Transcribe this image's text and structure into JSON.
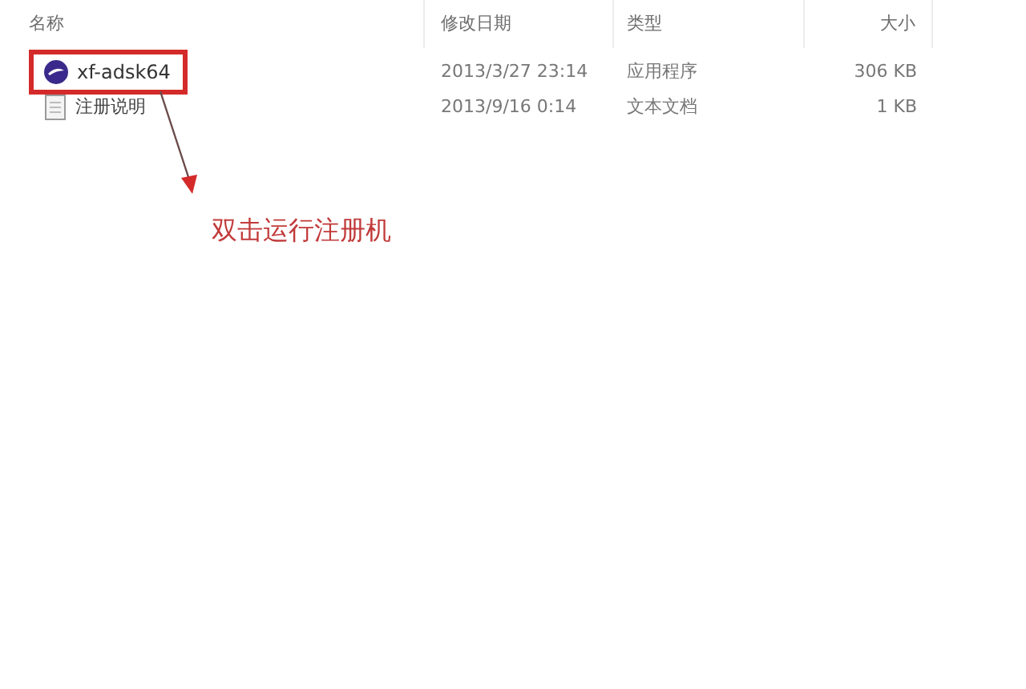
{
  "columns": [
    "名称",
    "修改日期",
    "类型",
    "大小"
  ],
  "files": [
    {
      "name": "xf-adsk64",
      "kind": "app",
      "date": "2013/3/27 23:14",
      "type": "应用程序",
      "size": "306 KB",
      "annotated": true
    },
    {
      "name": "注册说明",
      "kind": "text",
      "date": "2013/9/16 0:14",
      "type": "文本文档",
      "size": "1 KB",
      "annotated": false
    }
  ],
  "annotation": {
    "text": "双击运行注册机"
  }
}
